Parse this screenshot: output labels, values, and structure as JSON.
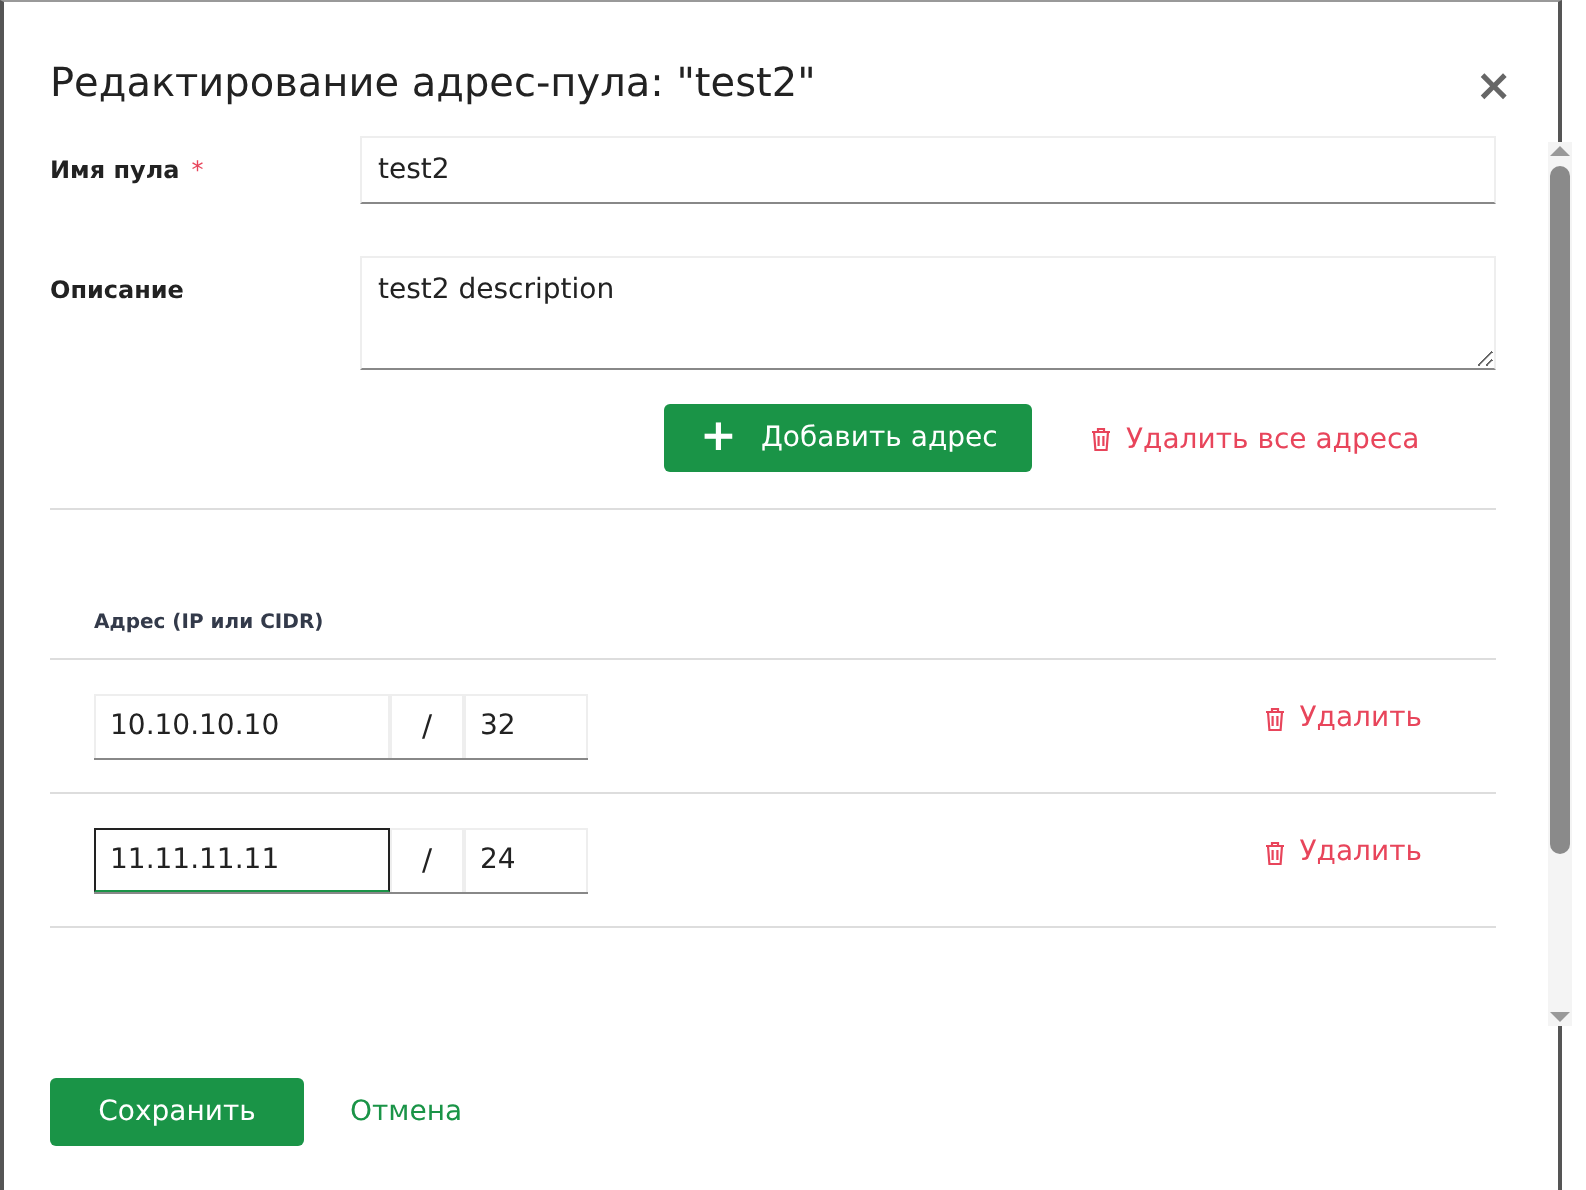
{
  "dialog": {
    "title": "Редактирование адрес-пула: \"test2\"",
    "close": "×"
  },
  "form": {
    "name_label": "Имя пула",
    "required_mark": "*",
    "name_value": "test2",
    "description_label": "Описание",
    "description_value": "test2 description"
  },
  "actions": {
    "add": {
      "icon": "+",
      "label": "Добавить адрес"
    },
    "delete_all": "Удалить все адреса"
  },
  "addresses": {
    "column": "Адрес (IP или CIDR)",
    "rows": [
      {
        "ip": "10.10.10.10",
        "slash": "/",
        "mask": "32",
        "focused": false,
        "delete": "Удалить"
      },
      {
        "ip": "11.11.11.11",
        "slash": "/",
        "mask": "24",
        "focused": true,
        "delete": "Удалить"
      }
    ]
  },
  "footer": {
    "save": "Сохранить",
    "cancel": "Отмена"
  }
}
